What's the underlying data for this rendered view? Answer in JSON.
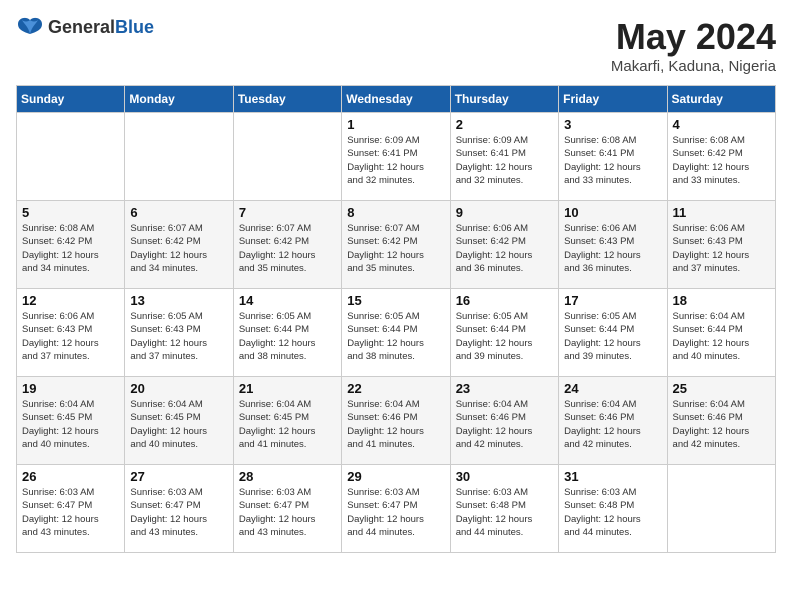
{
  "header": {
    "logo_general": "General",
    "logo_blue": "Blue",
    "month_year": "May 2024",
    "location": "Makarfi, Kaduna, Nigeria"
  },
  "days_of_week": [
    "Sunday",
    "Monday",
    "Tuesday",
    "Wednesday",
    "Thursday",
    "Friday",
    "Saturday"
  ],
  "weeks": [
    [
      {
        "day": "",
        "info": ""
      },
      {
        "day": "",
        "info": ""
      },
      {
        "day": "",
        "info": ""
      },
      {
        "day": "1",
        "info": "Sunrise: 6:09 AM\nSunset: 6:41 PM\nDaylight: 12 hours\nand 32 minutes."
      },
      {
        "day": "2",
        "info": "Sunrise: 6:09 AM\nSunset: 6:41 PM\nDaylight: 12 hours\nand 32 minutes."
      },
      {
        "day": "3",
        "info": "Sunrise: 6:08 AM\nSunset: 6:41 PM\nDaylight: 12 hours\nand 33 minutes."
      },
      {
        "day": "4",
        "info": "Sunrise: 6:08 AM\nSunset: 6:42 PM\nDaylight: 12 hours\nand 33 minutes."
      }
    ],
    [
      {
        "day": "5",
        "info": "Sunrise: 6:08 AM\nSunset: 6:42 PM\nDaylight: 12 hours\nand 34 minutes."
      },
      {
        "day": "6",
        "info": "Sunrise: 6:07 AM\nSunset: 6:42 PM\nDaylight: 12 hours\nand 34 minutes."
      },
      {
        "day": "7",
        "info": "Sunrise: 6:07 AM\nSunset: 6:42 PM\nDaylight: 12 hours\nand 35 minutes."
      },
      {
        "day": "8",
        "info": "Sunrise: 6:07 AM\nSunset: 6:42 PM\nDaylight: 12 hours\nand 35 minutes."
      },
      {
        "day": "9",
        "info": "Sunrise: 6:06 AM\nSunset: 6:42 PM\nDaylight: 12 hours\nand 36 minutes."
      },
      {
        "day": "10",
        "info": "Sunrise: 6:06 AM\nSunset: 6:43 PM\nDaylight: 12 hours\nand 36 minutes."
      },
      {
        "day": "11",
        "info": "Sunrise: 6:06 AM\nSunset: 6:43 PM\nDaylight: 12 hours\nand 37 minutes."
      }
    ],
    [
      {
        "day": "12",
        "info": "Sunrise: 6:06 AM\nSunset: 6:43 PM\nDaylight: 12 hours\nand 37 minutes."
      },
      {
        "day": "13",
        "info": "Sunrise: 6:05 AM\nSunset: 6:43 PM\nDaylight: 12 hours\nand 37 minutes."
      },
      {
        "day": "14",
        "info": "Sunrise: 6:05 AM\nSunset: 6:44 PM\nDaylight: 12 hours\nand 38 minutes."
      },
      {
        "day": "15",
        "info": "Sunrise: 6:05 AM\nSunset: 6:44 PM\nDaylight: 12 hours\nand 38 minutes."
      },
      {
        "day": "16",
        "info": "Sunrise: 6:05 AM\nSunset: 6:44 PM\nDaylight: 12 hours\nand 39 minutes."
      },
      {
        "day": "17",
        "info": "Sunrise: 6:05 AM\nSunset: 6:44 PM\nDaylight: 12 hours\nand 39 minutes."
      },
      {
        "day": "18",
        "info": "Sunrise: 6:04 AM\nSunset: 6:44 PM\nDaylight: 12 hours\nand 40 minutes."
      }
    ],
    [
      {
        "day": "19",
        "info": "Sunrise: 6:04 AM\nSunset: 6:45 PM\nDaylight: 12 hours\nand 40 minutes."
      },
      {
        "day": "20",
        "info": "Sunrise: 6:04 AM\nSunset: 6:45 PM\nDaylight: 12 hours\nand 40 minutes."
      },
      {
        "day": "21",
        "info": "Sunrise: 6:04 AM\nSunset: 6:45 PM\nDaylight: 12 hours\nand 41 minutes."
      },
      {
        "day": "22",
        "info": "Sunrise: 6:04 AM\nSunset: 6:46 PM\nDaylight: 12 hours\nand 41 minutes."
      },
      {
        "day": "23",
        "info": "Sunrise: 6:04 AM\nSunset: 6:46 PM\nDaylight: 12 hours\nand 42 minutes."
      },
      {
        "day": "24",
        "info": "Sunrise: 6:04 AM\nSunset: 6:46 PM\nDaylight: 12 hours\nand 42 minutes."
      },
      {
        "day": "25",
        "info": "Sunrise: 6:04 AM\nSunset: 6:46 PM\nDaylight: 12 hours\nand 42 minutes."
      }
    ],
    [
      {
        "day": "26",
        "info": "Sunrise: 6:03 AM\nSunset: 6:47 PM\nDaylight: 12 hours\nand 43 minutes."
      },
      {
        "day": "27",
        "info": "Sunrise: 6:03 AM\nSunset: 6:47 PM\nDaylight: 12 hours\nand 43 minutes."
      },
      {
        "day": "28",
        "info": "Sunrise: 6:03 AM\nSunset: 6:47 PM\nDaylight: 12 hours\nand 43 minutes."
      },
      {
        "day": "29",
        "info": "Sunrise: 6:03 AM\nSunset: 6:47 PM\nDaylight: 12 hours\nand 44 minutes."
      },
      {
        "day": "30",
        "info": "Sunrise: 6:03 AM\nSunset: 6:48 PM\nDaylight: 12 hours\nand 44 minutes."
      },
      {
        "day": "31",
        "info": "Sunrise: 6:03 AM\nSunset: 6:48 PM\nDaylight: 12 hours\nand 44 minutes."
      },
      {
        "day": "",
        "info": ""
      }
    ]
  ]
}
